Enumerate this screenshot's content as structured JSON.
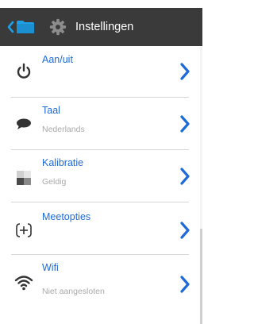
{
  "appbar": {
    "title": "Instellingen"
  },
  "colors": {
    "appbar_bg": "#3a3a3a",
    "accent": "#1e6ad6",
    "secondary_text": "#a9a9a9",
    "icon_dark": "#333333"
  },
  "items": [
    {
      "label": "Aan/uit",
      "sublabel": "",
      "icon": "power-icon"
    },
    {
      "label": "Taal",
      "sublabel": "Nederlands",
      "icon": "speech-bubble-icon"
    },
    {
      "label": "Kalibratie",
      "sublabel": "Geldig",
      "icon": "calibration-icon"
    },
    {
      "label": "Meetopties",
      "sublabel": "",
      "icon": "measure-options-icon"
    },
    {
      "label": "Wifi",
      "sublabel": "Niet aangesloten",
      "icon": "wifi-icon"
    }
  ]
}
